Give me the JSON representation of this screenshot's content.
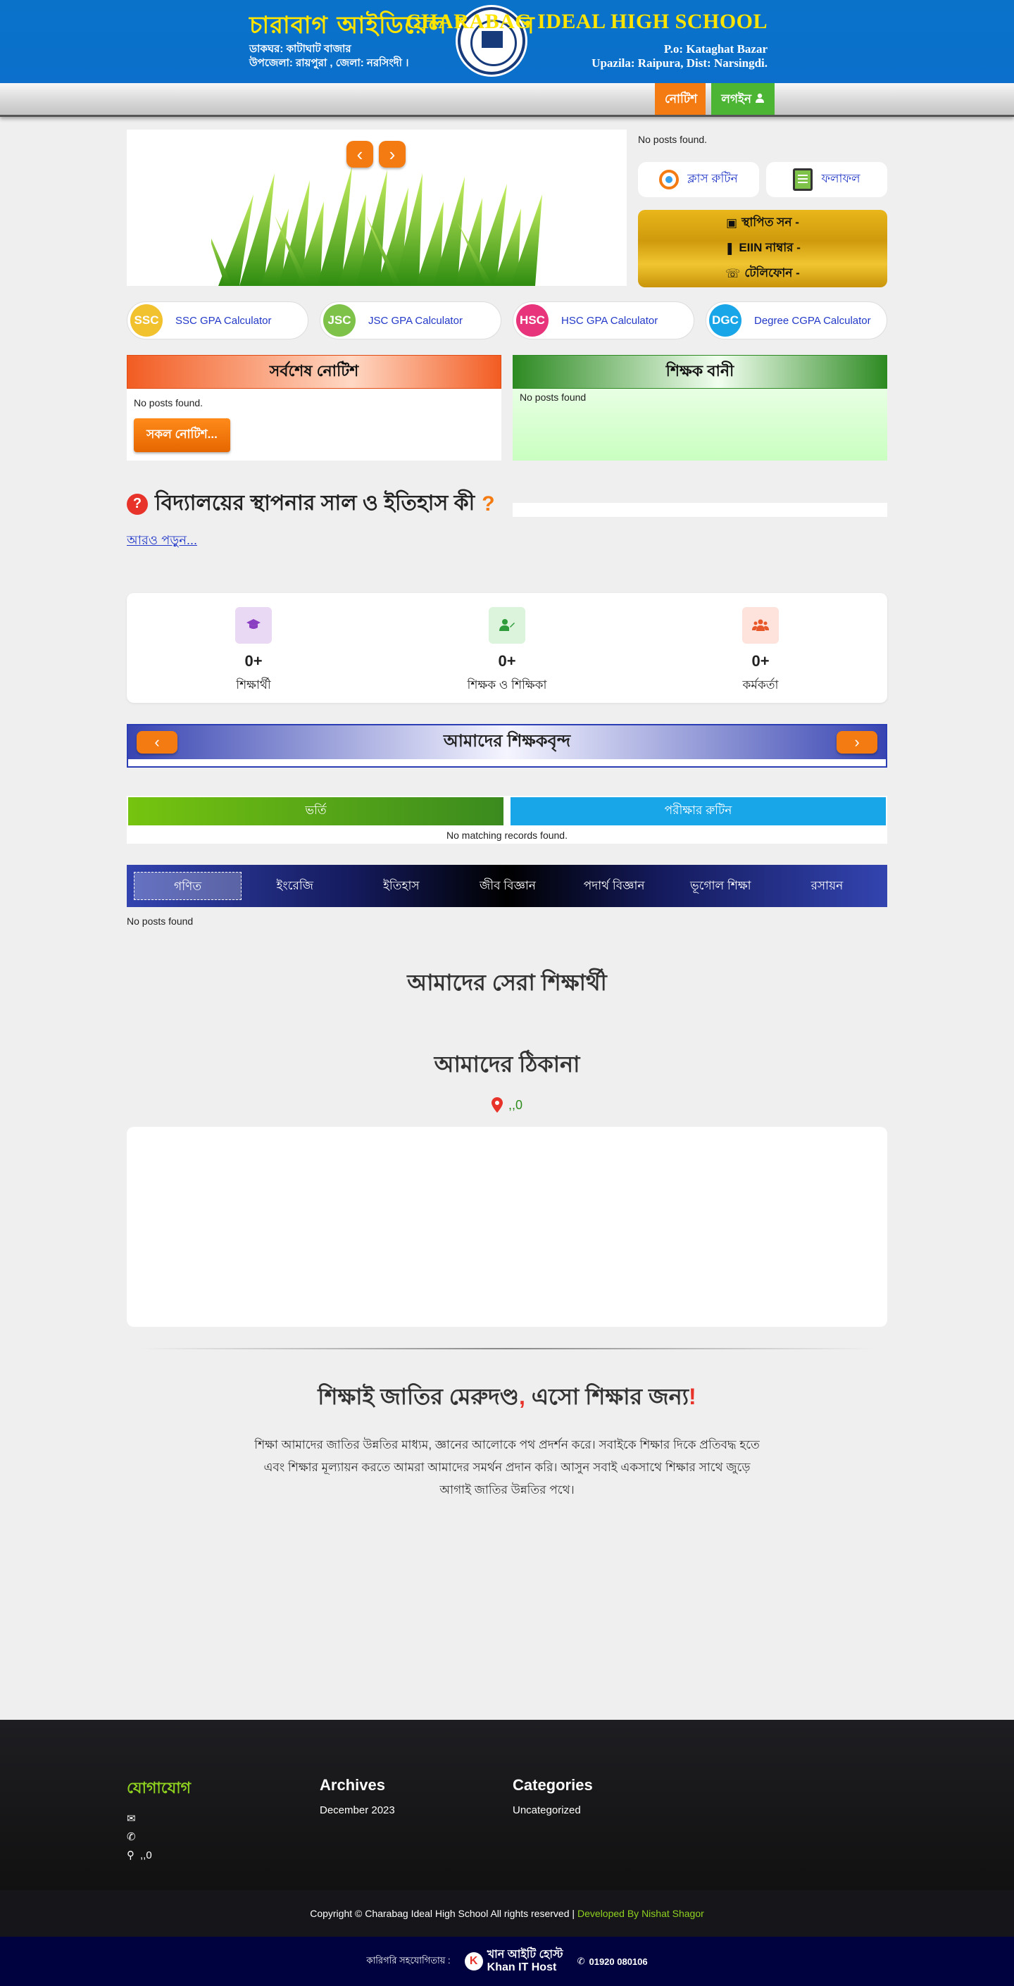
{
  "header": {
    "title_bn": "চারাবাগ আইডিয়েল হাই স্কুল",
    "addr_bn_1": "ডাকঘর: কাটাঘাট বাজার",
    "addr_bn_2": "উপজেলা: রায়পুরা , জেলা: নরসিংদী ।",
    "title_en": "CHARABAG IDEAL HIGH SCHOOL",
    "po_en": "P.o: Kataghat Bazar",
    "upazila_en": "Upazila: Raipura, Dist: Narsingdi.",
    "colors": {
      "banner": "#0b6fcb",
      "title": "#ffe400"
    }
  },
  "nav": {
    "notice": "নোটিশ",
    "login": "লগইন"
  },
  "slider": {
    "prev": "‹",
    "next": "›"
  },
  "side": {
    "no_posts": "No posts found.",
    "class_routine": "ক্লাস রুটিন",
    "result": "ফলাফল",
    "established": "স্থাপিত সন -",
    "eiin": "EIIN নাম্বার -",
    "phone": "টেলিফোন -"
  },
  "calculators": [
    {
      "badge": "SSC",
      "label": "SSC GPA Calculator",
      "color": "#f2c12e"
    },
    {
      "badge": "JSC",
      "label": "JSC GPA Calculator",
      "color": "#7fc24a"
    },
    {
      "badge": "HSC",
      "label": "HSC GPA Calculator",
      "color": "#e8347a"
    },
    {
      "badge": "DGC",
      "label": "Degree CGPA Calculator",
      "color": "#19a6e8"
    }
  ],
  "notices": {
    "latest_title": "সর্বশেষ নোটিশ",
    "latest_empty": "No posts found.",
    "all_btn": "সকল নোটিশ...",
    "teacher_title": "শিক্ষক বানী",
    "teacher_empty": "No posts found"
  },
  "history": {
    "icon": "?",
    "title": "বিদ্যালয়ের স্থাপনার সাল ও ইতিহাস কী",
    "mark": "?",
    "more": "আরও পড়ুন..."
  },
  "stats": [
    {
      "value": "0+",
      "label": "শিক্ষার্থী",
      "icon": "graduate-icon",
      "bg": "#ead9f5",
      "fg": "#8a3fc2"
    },
    {
      "value": "0+",
      "label": "শিক্ষক ও শিক্ষিকা",
      "icon": "teacher-icon",
      "bg": "#dcf3dc",
      "fg": "#2e9c3a"
    },
    {
      "value": "0+",
      "label": "কর্মকর্তা",
      "icon": "staff-icon",
      "bg": "#fde3dc",
      "fg": "#e8572a"
    }
  ],
  "teachers": {
    "title": "আমাদের শিক্ষকবৃন্দ",
    "prev": "‹",
    "next": "›"
  },
  "tables": {
    "admission": "ভর্তি",
    "exam_routine": "পরীক্ষার রুটিন",
    "empty": "No matching records found."
  },
  "subjects": {
    "items": [
      "গণিত",
      "ইংরেজি",
      "ইতিহাস",
      "জীব বিজ্ঞান",
      "পদার্থ বিজ্ঞান",
      "ভূগোল শিক্ষা",
      "রসায়ন"
    ],
    "active": 0,
    "empty": "No posts found"
  },
  "best_students": "আমাদের সেরা শিক্ষার্থী",
  "address": {
    "title": "আমাদের ঠিকানা",
    "value": ",,0"
  },
  "motto": {
    "part1": "শিক্ষাই জাতির মেরুদণ্ড",
    "comma": ",",
    "part2": " এসো শিক্ষার জন্য",
    "bang": "!",
    "paragraph": "শিক্ষা আমাদের জাতির উন্নতির মাধ্যম, জ্ঞানের আলোকে পথ প্রদর্শন করে। সবাইকে শিক্ষার দিকে প্রতিবদ্ধ হতে এবং শিক্ষার মূল্যায়ন করতে আমরা আমাদের সমর্থন প্রদান করি। আসুন সবাই একসাথে শিক্ষার সাথে জুড়ে আগাই জাতির উন্নতির পথে।"
  },
  "footer": {
    "contact_title": "যোগাযোগ",
    "contact_addr": ",,0",
    "archives_title": "Archives",
    "archive_item": "December 2023",
    "categories_title": "Categories",
    "category_item": "Uncategorized",
    "copyright": "Copyright © Charabag Ideal High School All rights reserved |",
    "developer": "Developed By Nishat Shagor",
    "tech_partner": "কারিগরি সহযোগিতায় :",
    "host_bn": "খান আইটি হোস্ট",
    "host_en": "Khan IT Host",
    "phone": "01920 080106"
  }
}
